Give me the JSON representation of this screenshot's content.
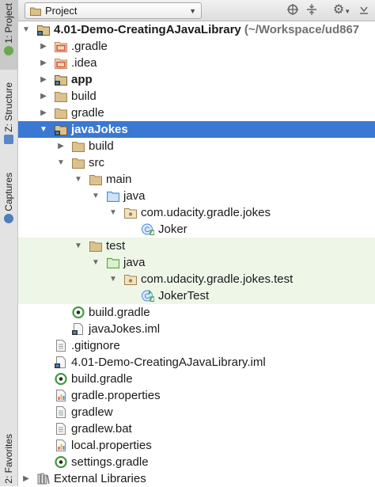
{
  "side_tabs": {
    "project": "1: Project",
    "structure": "Z: Structure",
    "captures": "Captures",
    "favorites": "2: Favorites"
  },
  "toolbar": {
    "view_label": "Project",
    "buttons": [
      "target-icon",
      "collapse-icon",
      "gear-icon",
      "hide-icon"
    ]
  },
  "tree": [
    {
      "label": "4.01-Demo-CreatingAJavaLibrary",
      "suffix": " (~/Workspace/ud867",
      "depth": 0,
      "arrow": "open",
      "icon": "module",
      "bold": true
    },
    {
      "label": ".gradle",
      "depth": 1,
      "arrow": "closed",
      "icon": "folder-red"
    },
    {
      "label": ".idea",
      "depth": 1,
      "arrow": "closed",
      "icon": "folder-red"
    },
    {
      "label": "app",
      "depth": 1,
      "arrow": "closed",
      "icon": "module",
      "bold": true
    },
    {
      "label": "build",
      "depth": 1,
      "arrow": "closed",
      "icon": "folder"
    },
    {
      "label": "gradle",
      "depth": 1,
      "arrow": "closed",
      "icon": "folder"
    },
    {
      "label": "javaJokes",
      "depth": 1,
      "arrow": "open",
      "icon": "module",
      "bold": true,
      "selected": true
    },
    {
      "label": "build",
      "depth": 2,
      "arrow": "closed",
      "icon": "folder"
    },
    {
      "label": "src",
      "depth": 2,
      "arrow": "open",
      "icon": "folder"
    },
    {
      "label": "main",
      "depth": 3,
      "arrow": "open",
      "icon": "folder"
    },
    {
      "label": "java",
      "depth": 4,
      "arrow": "open",
      "icon": "folder-blue"
    },
    {
      "label": "com.udacity.gradle.jokes",
      "depth": 5,
      "arrow": "open",
      "icon": "package"
    },
    {
      "label": "Joker",
      "depth": 6,
      "arrow": "none",
      "icon": "class"
    },
    {
      "label": "test",
      "depth": 3,
      "arrow": "open",
      "icon": "folder",
      "green": true
    },
    {
      "label": "java",
      "depth": 4,
      "arrow": "open",
      "icon": "folder-green",
      "green": true
    },
    {
      "label": "com.udacity.gradle.jokes.test",
      "depth": 5,
      "arrow": "open",
      "icon": "package",
      "green": true
    },
    {
      "label": "JokerTest",
      "depth": 6,
      "arrow": "none",
      "icon": "class-test",
      "green": true
    },
    {
      "label": "build.gradle",
      "depth": 2,
      "arrow": "none",
      "icon": "gradle"
    },
    {
      "label": "javaJokes.iml",
      "depth": 2,
      "arrow": "none",
      "icon": "iml"
    },
    {
      "label": ".gitignore",
      "depth": 1,
      "arrow": "none",
      "icon": "file"
    },
    {
      "label": "4.01-Demo-CreatingAJavaLibrary.iml",
      "depth": 1,
      "arrow": "none",
      "icon": "iml"
    },
    {
      "label": "build.gradle",
      "depth": 1,
      "arrow": "none",
      "icon": "gradle"
    },
    {
      "label": "gradle.properties",
      "depth": 1,
      "arrow": "none",
      "icon": "properties"
    },
    {
      "label": "gradlew",
      "depth": 1,
      "arrow": "none",
      "icon": "file"
    },
    {
      "label": "gradlew.bat",
      "depth": 1,
      "arrow": "none",
      "icon": "file"
    },
    {
      "label": "local.properties",
      "depth": 1,
      "arrow": "none",
      "icon": "properties"
    },
    {
      "label": "settings.gradle",
      "depth": 1,
      "arrow": "none",
      "icon": "gradle"
    },
    {
      "label": "External Libraries",
      "depth": 0,
      "arrow": "closed",
      "icon": "library"
    }
  ],
  "colors": {
    "selection": "#3a78d4",
    "test_bg": "#eef6e8",
    "folder": "#c7a15c",
    "source_folder": "#4a8fd8",
    "test_folder": "#58a838",
    "excluded_folder": "#d9544d",
    "gradle_icon": "#3b9b3b"
  }
}
